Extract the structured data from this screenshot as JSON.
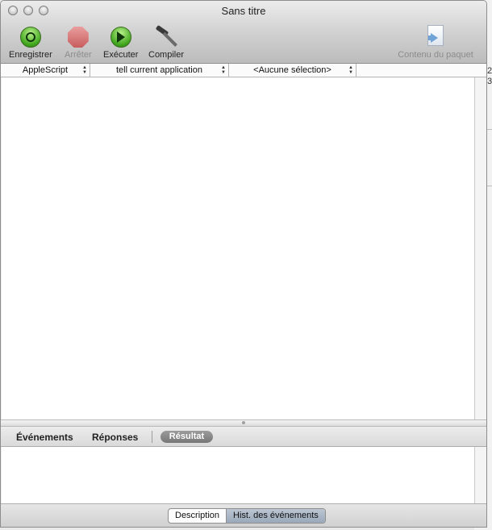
{
  "window": {
    "title": "Sans titre"
  },
  "toolbar": {
    "record_label": "Enregistrer",
    "stop_label": "Arrêter",
    "run_label": "Exécuter",
    "compile_label": "Compiler",
    "bundle_contents_label": "Contenu du paquet"
  },
  "navbar": {
    "language": "AppleScript",
    "target": "tell current application",
    "selection": "<Aucune sélection>"
  },
  "bottom_tabs": {
    "events": "Événements",
    "replies": "Réponses",
    "result": "Résultat"
  },
  "footer": {
    "description": "Description",
    "event_log": "Hist. des événements"
  },
  "background": {
    "tick_top": "2",
    "tick_bottom": "3"
  }
}
